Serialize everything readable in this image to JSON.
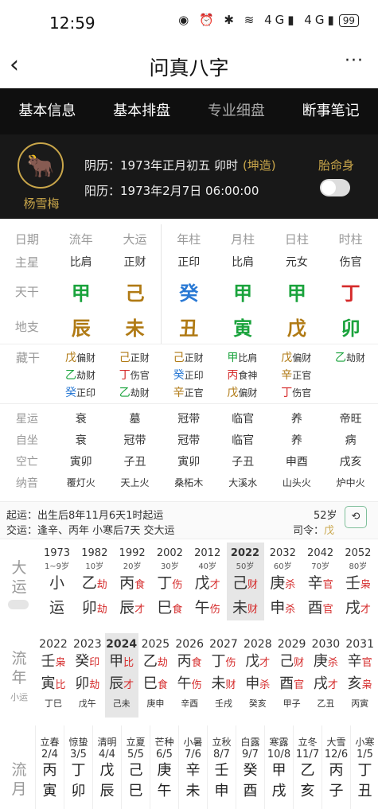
{
  "status": {
    "time": "12:59",
    "icons": "◉ ⏰ ✱ ≋ 4G▮ 4G▮",
    "battery": "99"
  },
  "header": {
    "title": "问真八字",
    "back": "‹",
    "more": "···"
  },
  "tabs": [
    "基本信息",
    "基本排盘",
    "专业细盘",
    "断事笔记"
  ],
  "profile": {
    "name": "杨雪梅",
    "lunar": "阴历：1973年正月初五 卯时",
    "lunar_tag": "(坤造)",
    "solar": "阳历：1973年2月7日 06:00:00",
    "taiming": "胎命身"
  },
  "grid": {
    "head": [
      "日期",
      "流年",
      "大运",
      "年柱",
      "月柱",
      "日柱",
      "时柱"
    ],
    "zhuxing": [
      "主星",
      "比肩",
      "正财",
      "正印",
      "比肩",
      "元女",
      "伤官"
    ],
    "tiangan_label": "天干",
    "tiangan": [
      {
        "t": "甲",
        "c": "grn"
      },
      {
        "t": "己",
        "c": "brn"
      },
      {
        "t": "癸",
        "c": "blu"
      },
      {
        "t": "甲",
        "c": "grn"
      },
      {
        "t": "甲",
        "c": "grn"
      },
      {
        "t": "丁",
        "c": "red"
      }
    ],
    "dizhi_label": "地支",
    "dizhi": [
      {
        "t": "辰",
        "c": "brn"
      },
      {
        "t": "未",
        "c": "brn"
      },
      {
        "t": "丑",
        "c": "brn"
      },
      {
        "t": "寅",
        "c": "grn"
      },
      {
        "t": "戊",
        "c": "brn"
      },
      {
        "t": "卯",
        "c": "grn"
      }
    ]
  },
  "hidden": {
    "label": "藏干",
    "cols": [
      [
        {
          "g": "戊",
          "c": "brn",
          "s": "偏财"
        },
        {
          "g": "乙",
          "c": "grn",
          "s": "劫财"
        },
        {
          "g": "癸",
          "c": "blu",
          "s": "正印"
        }
      ],
      [
        {
          "g": "己",
          "c": "brn",
          "s": "正财"
        },
        {
          "g": "丁",
          "c": "red",
          "s": "伤官"
        },
        {
          "g": "乙",
          "c": "grn",
          "s": "劫财"
        }
      ],
      [
        {
          "g": "己",
          "c": "brn",
          "s": "正财"
        },
        {
          "g": "癸",
          "c": "blu",
          "s": "正印"
        },
        {
          "g": "辛",
          "c": "brn",
          "s": "正官"
        }
      ],
      [
        {
          "g": "甲",
          "c": "grn",
          "s": "比肩"
        },
        {
          "g": "丙",
          "c": "red",
          "s": "食神"
        },
        {
          "g": "戊",
          "c": "brn",
          "s": "偏财"
        }
      ],
      [
        {
          "g": "戊",
          "c": "brn",
          "s": "偏财"
        },
        {
          "g": "辛",
          "c": "brn",
          "s": "正官"
        },
        {
          "g": "丁",
          "c": "red",
          "s": "伤官"
        }
      ],
      [
        {
          "g": "乙",
          "c": "grn",
          "s": "劫财"
        }
      ]
    ]
  },
  "xingyun": [
    [
      "星运",
      "衰",
      "墓",
      "冠带",
      "临官",
      "养",
      "帝旺"
    ],
    [
      "自坐",
      "衰",
      "冠带",
      "冠带",
      "临官",
      "养",
      "病"
    ],
    [
      "空亡",
      "寅卯",
      "子丑",
      "寅卯",
      "子丑",
      "申酉",
      "戌亥"
    ],
    [
      "纳音",
      "覆灯火",
      "天上火",
      "桑柘木",
      "大溪水",
      "山头火",
      "炉中火"
    ]
  ],
  "qiyun": {
    "line1": "起运：出生后8年11月6天1时起运",
    "line2": "交运：逢辛、丙年 小寒后7天 交大运",
    "age": "52岁",
    "siling": "司令：",
    "siling_val": "戊",
    "calib": "⟲"
  },
  "dayun": {
    "label": "大运",
    "cols": [
      {
        "y": "1973",
        "a": "1~9岁",
        "g1": "小",
        "s1": "",
        "g2": "运",
        "s2": "",
        "c1": "",
        "c2": ""
      },
      {
        "y": "1982",
        "a": "10岁",
        "g1": "乙",
        "s1": "劫",
        "g2": "卯",
        "s2": "劫",
        "c1": "",
        "c2": ""
      },
      {
        "y": "1992",
        "a": "20岁",
        "g1": "丙",
        "s1": "食",
        "g2": "辰",
        "s2": "才",
        "c1": "",
        "c2": ""
      },
      {
        "y": "2002",
        "a": "30岁",
        "g1": "丁",
        "s1": "伤",
        "g2": "巳",
        "s2": "食",
        "c1": "",
        "c2": ""
      },
      {
        "y": "2012",
        "a": "40岁",
        "g1": "戊",
        "s1": "才",
        "g2": "午",
        "s2": "伤",
        "c1": "",
        "c2": ""
      },
      {
        "y": "2022",
        "a": "50岁",
        "g1": "己",
        "s1": "财",
        "g2": "未",
        "s2": "财",
        "c1": "",
        "c2": ""
      },
      {
        "y": "2032",
        "a": "60岁",
        "g1": "庚",
        "s1": "杀",
        "g2": "申",
        "s2": "杀",
        "c1": "",
        "c2": ""
      },
      {
        "y": "2042",
        "a": "70岁",
        "g1": "辛",
        "s1": "官",
        "g2": "酉",
        "s2": "官",
        "c1": "",
        "c2": ""
      },
      {
        "y": "2052",
        "a": "80岁",
        "g1": "壬",
        "s1": "枭",
        "g2": "戌",
        "s2": "才",
        "c1": "",
        "c2": ""
      }
    ]
  },
  "liunian": {
    "label": "流年",
    "sub": "小运",
    "cols": [
      {
        "y": "2022",
        "g1": "壬",
        "s1": "枭",
        "g2": "寅",
        "s2": "比",
        "x": "丁巳"
      },
      {
        "y": "2023",
        "g1": "癸",
        "s1": "印",
        "g2": "卯",
        "s2": "劫",
        "x": "戊午"
      },
      {
        "y": "2024",
        "g1": "甲",
        "s1": "比",
        "g2": "辰",
        "s2": "才",
        "x": "己未"
      },
      {
        "y": "2025",
        "g1": "乙",
        "s1": "劫",
        "g2": "巳",
        "s2": "食",
        "x": "庚申"
      },
      {
        "y": "2026",
        "g1": "丙",
        "s1": "食",
        "g2": "午",
        "s2": "伤",
        "x": "辛酉"
      },
      {
        "y": "2027",
        "g1": "丁",
        "s1": "伤",
        "g2": "未",
        "s2": "财",
        "x": "壬戌"
      },
      {
        "y": "2028",
        "g1": "戊",
        "s1": "才",
        "g2": "申",
        "s2": "杀",
        "x": "癸亥"
      },
      {
        "y": "2029",
        "g1": "己",
        "s1": "财",
        "g2": "酉",
        "s2": "官",
        "x": "甲子"
      },
      {
        "y": "2030",
        "g1": "庚",
        "s1": "杀",
        "g2": "戌",
        "s2": "才",
        "x": "乙丑"
      },
      {
        "y": "2031",
        "g1": "辛",
        "s1": "官",
        "g2": "亥",
        "s2": "枭",
        "x": "丙寅"
      }
    ]
  },
  "liuyue": {
    "label": "流月",
    "cols": [
      {
        "t": "立春",
        "d": "2/4",
        "g1": "丙",
        "g2": "寅"
      },
      {
        "t": "惊蛰",
        "d": "3/5",
        "g1": "丁",
        "g2": "卯"
      },
      {
        "t": "清明",
        "d": "4/4",
        "g1": "戊",
        "g2": "辰"
      },
      {
        "t": "立夏",
        "d": "5/5",
        "g1": "己",
        "g2": "巳"
      },
      {
        "t": "芒种",
        "d": "6/5",
        "g1": "庚",
        "g2": "午"
      },
      {
        "t": "小暑",
        "d": "7/6",
        "g1": "辛",
        "g2": "未"
      },
      {
        "t": "立秋",
        "d": "8/7",
        "g1": "壬",
        "g2": "申"
      },
      {
        "t": "白露",
        "d": "9/7",
        "g1": "癸",
        "g2": "酉"
      },
      {
        "t": "寒露",
        "d": "10/8",
        "g1": "甲",
        "g2": "戌"
      },
      {
        "t": "立冬",
        "d": "11/7",
        "g1": "乙",
        "g2": "亥"
      },
      {
        "t": "大雪",
        "d": "12/6",
        "g1": "丙",
        "g2": "子"
      },
      {
        "t": "小寒",
        "d": "1/5",
        "g1": "丁",
        "g2": "丑"
      }
    ]
  }
}
